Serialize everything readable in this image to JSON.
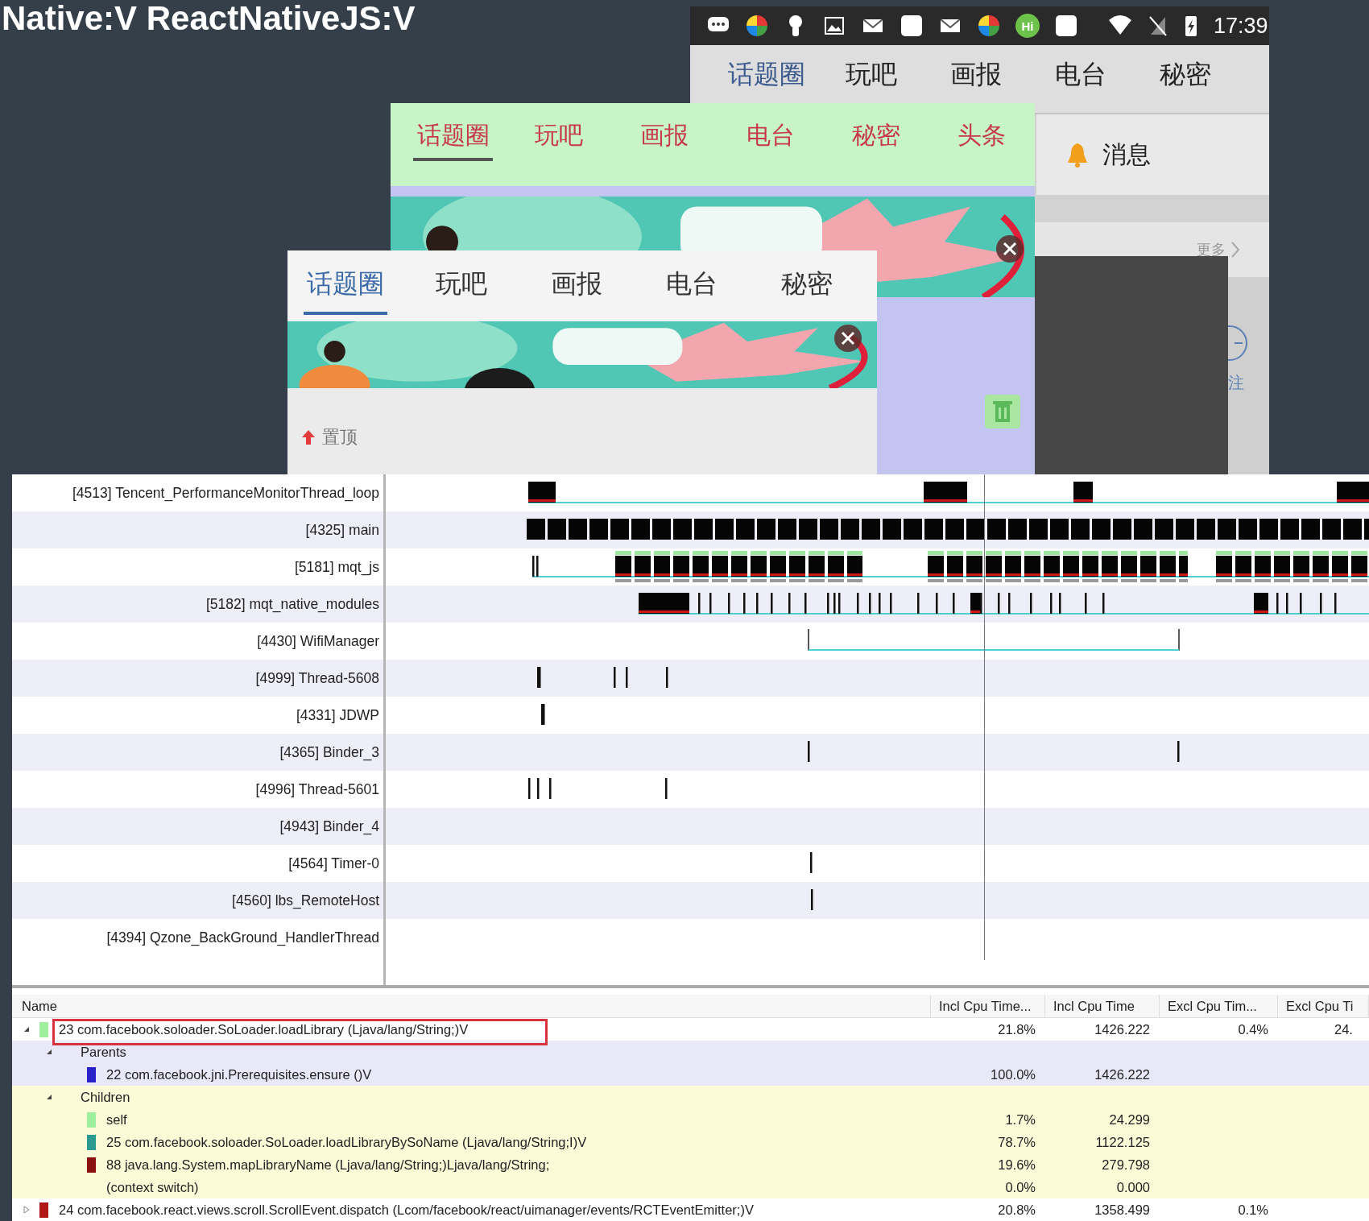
{
  "slide_title": "Native:V ReactNativeJS:V",
  "phone_back": {
    "status_bar": {
      "badge": "Hi",
      "time": "17:39"
    },
    "tabs": [
      {
        "label": "话题圈",
        "selected": true
      },
      {
        "label": "玩吧",
        "selected": false
      },
      {
        "label": "画报",
        "selected": false
      },
      {
        "label": "电台",
        "selected": false
      },
      {
        "label": "秘密",
        "selected": false
      }
    ],
    "message_label": "消息",
    "more_link": "更多",
    "follow_label": "注"
  },
  "phone_middle": {
    "tabs": [
      {
        "label": "话题圈",
        "selected": true
      },
      {
        "label": "玩吧",
        "selected": false
      },
      {
        "label": "画报",
        "selected": false
      },
      {
        "label": "电台",
        "selected": false
      },
      {
        "label": "秘密",
        "selected": false
      },
      {
        "label": "头条",
        "selected": false
      }
    ]
  },
  "phone_front": {
    "tabs": [
      {
        "label": "话题圈",
        "selected": true
      },
      {
        "label": "玩吧",
        "selected": false
      },
      {
        "label": "画报",
        "selected": false
      },
      {
        "label": "电台",
        "selected": false
      },
      {
        "label": "秘密",
        "selected": false
      }
    ],
    "pin_label": "置顶"
  },
  "profiler": {
    "threads": [
      {
        "label": "[4513] Tencent_PerformanceMonitorThread_loop"
      },
      {
        "label": "[4325] main"
      },
      {
        "label": "[5181] mqt_js"
      },
      {
        "label": "[5182] mqt_native_modules"
      },
      {
        "label": "[4430] WifiManager"
      },
      {
        "label": "[4999] Thread-5608"
      },
      {
        "label": "[4331] JDWP"
      },
      {
        "label": "[4365] Binder_3"
      },
      {
        "label": "[4996] Thread-5601"
      },
      {
        "label": "[4943] Binder_4"
      },
      {
        "label": "[4564] Timer-0"
      },
      {
        "label": "[4560] lbs_RemoteHost"
      },
      {
        "label": "[4394] Qzone_BackGround_HandlerThread"
      }
    ],
    "table": {
      "columns": [
        "Name",
        "Incl Cpu Time...",
        "Incl Cpu Time",
        "Excl Cpu Tim...",
        "Excl Cpu Ti"
      ],
      "rows": [
        {
          "name": "23 com.facebook.soloader.SoLoader.loadLibrary (Ljava/lang/String;)V",
          "color": "#9ef09e",
          "expanded": true,
          "boxed": true,
          "values": [
            "21.8%",
            "1426.222",
            "0.4%",
            "24."
          ],
          "groups": [
            {
              "kind": "parents",
              "label": "Parents",
              "expanded": true,
              "items": [
                {
                  "name": "22 com.facebook.jni.Prerequisites.ensure ()V",
                  "color": "#2a22c8",
                  "values": [
                    "100.0%",
                    "1426.222"
                  ]
                }
              ]
            },
            {
              "kind": "children",
              "label": "Children",
              "expanded": true,
              "items": [
                {
                  "name": "self",
                  "color": "#9ef09e",
                  "values": [
                    "1.7%",
                    "24.299"
                  ]
                },
                {
                  "name": "25 com.facebook.soloader.SoLoader.loadLibraryBySoName (Ljava/lang/String;I)V",
                  "color": "#2a9a90",
                  "values": [
                    "78.7%",
                    "1122.125"
                  ]
                },
                {
                  "name": "88 java.lang.System.mapLibraryName (Ljava/lang/String;)Ljava/lang/String;",
                  "color": "#8a1010",
                  "values": [
                    "19.6%",
                    "279.798"
                  ]
                },
                {
                  "name": "(context switch)",
                  "values": [
                    "0.0%",
                    "0.000"
                  ]
                }
              ]
            }
          ]
        },
        {
          "name": "24 com.facebook.react.views.scroll.ScrollEvent.dispatch (Lcom/facebook/react/uimanager/events/RCTEventEmitter;)V",
          "color": "#b01818",
          "expanded": false,
          "boxed": false,
          "values": [
            "20.8%",
            "1358.499",
            "0.1%"
          ]
        }
      ]
    }
  }
}
